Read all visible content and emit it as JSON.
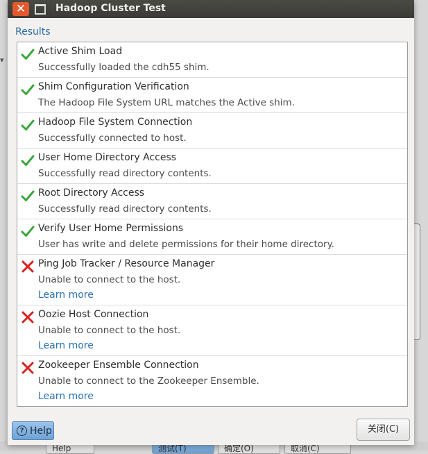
{
  "window": {
    "title": "Hadoop Cluster Test"
  },
  "results_label": "Results",
  "results": [
    {
      "status": "success",
      "title": "Active Shim Load",
      "message": "Successfully loaded the cdh55 shim."
    },
    {
      "status": "success",
      "title": "Shim Configuration Verification",
      "message": "The Hadoop File System URL matches the Active shim."
    },
    {
      "status": "success",
      "title": "Hadoop File System Connection",
      "message": "Successfully connected to host."
    },
    {
      "status": "success",
      "title": "User Home Directory Access",
      "message": "Successfully read directory contents."
    },
    {
      "status": "success",
      "title": "Root Directory Access",
      "message": "Successfully read directory contents."
    },
    {
      "status": "success",
      "title": "Verify User Home Permissions",
      "message": "User has write and delete permissions for their home directory."
    },
    {
      "status": "failure",
      "title": "Ping Job Tracker / Resource Manager",
      "message": "Unable to connect to the host.",
      "link": "Learn more"
    },
    {
      "status": "failure",
      "title": "Oozie Host Connection",
      "message": "Unable to connect to the host.",
      "link": "Learn more"
    },
    {
      "status": "failure",
      "title": "Zookeeper Ensemble Connection",
      "message": "Unable to connect to the Zookeeper Ensemble.",
      "link": "Learn more"
    }
  ],
  "buttons": {
    "help": "Help",
    "close": "关闭(C)"
  },
  "background_buttons": [
    "Help",
    "测试(T)",
    "确定(O)",
    "取消(C)"
  ],
  "colors": {
    "success": "#3aa63a",
    "failure": "#d9221f",
    "link": "#2b73b8",
    "close_button": "#e25a2c"
  }
}
